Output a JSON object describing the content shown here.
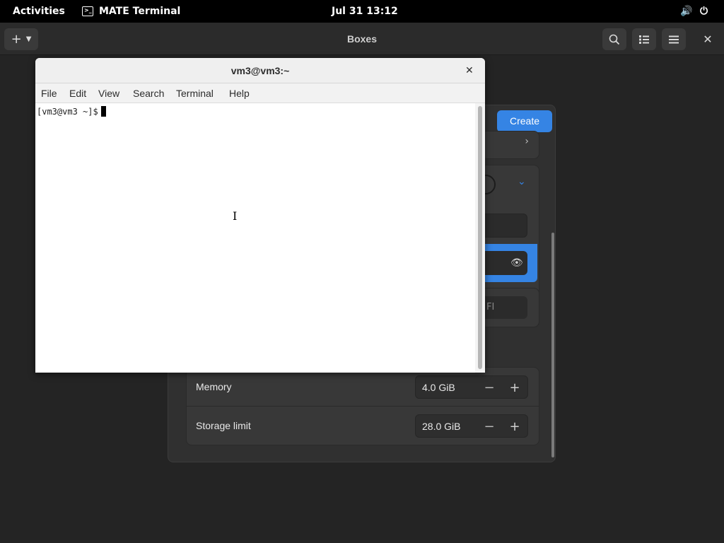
{
  "topbar": {
    "activities": "Activities",
    "app_name": "MATE Terminal",
    "clock": "Jul 31  13:12",
    "icons": [
      "terminal-icon",
      "volume-icon",
      "power-icon"
    ]
  },
  "boxes": {
    "title": "Boxes",
    "new_button_glyph": "+",
    "header_icons": [
      "plus-icon",
      "chevron-down-icon",
      "search-icon",
      "list-view-icon",
      "menu-icon",
      "close-icon"
    ]
  },
  "dialog": {
    "create_label": "Create",
    "firmware_partial": "FI",
    "memory_label": "Memory",
    "memory_value": "4.0 GiB",
    "storage_label": "Storage limit",
    "storage_value": "28.0 GiB",
    "accent_color": "#3584e4"
  },
  "terminal": {
    "title": "vm3@vm3:~",
    "menus": {
      "file": "File",
      "edit": "Edit",
      "view": "View",
      "search": "Search",
      "terminal": "Terminal",
      "help": "Help"
    },
    "prompt": "[vm3@vm3 ~]$"
  }
}
